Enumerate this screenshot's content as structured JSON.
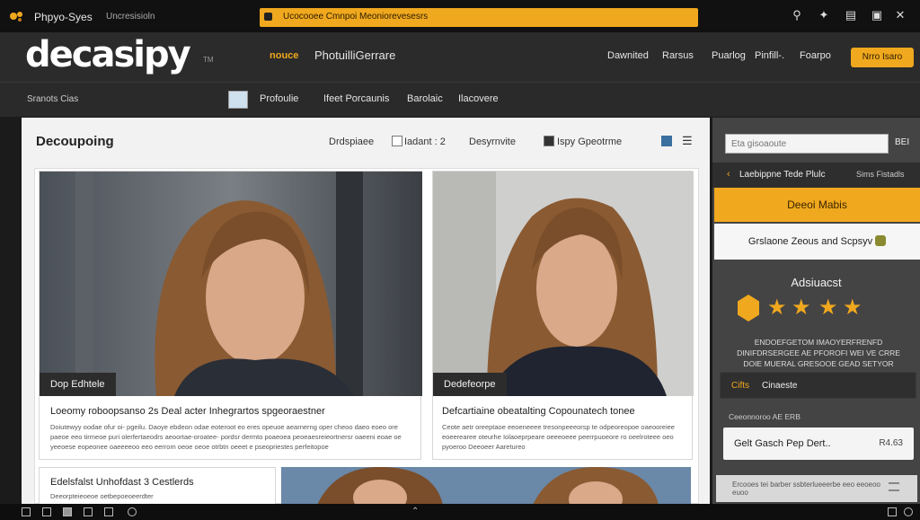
{
  "topbar": {
    "app_name": "Phpyo-Syes",
    "app_sub": "Uncresisioln",
    "url_text": "Ucocooee Cmnpoi Meoniorevesesrs",
    "icons": [
      "search-icon",
      "tools-icon",
      "bookmark-icon",
      "screen-icon",
      "close-icon"
    ]
  },
  "header": {
    "logo": "decasipy",
    "logo_tm": "TM",
    "nav_active": "nouce",
    "nav_site": "PhotuilliGerrare",
    "nav_items": [
      "Dawnited",
      "Rarsus",
      "Puarlog",
      "Pinfill-.",
      "Foarpo"
    ],
    "cta_label": "Nrro Isaro"
  },
  "subbar": {
    "left": "Sranots Cias",
    "items": [
      "Profoulie",
      "Ifeet Porcaunis",
      "Barolaic",
      "Ilacovere"
    ]
  },
  "main": {
    "title": "Decoupoing",
    "control_1": "Drdspiaee",
    "control_2": "Iadant : 2",
    "control_3": "Desyrnvite",
    "control_4": "Ispy Gpeotrme",
    "cards": [
      {
        "tag": "Dop Edhtele",
        "title": "Loeomy roboopsanso 2s Deal acter Inhegrartos spgeoraestner",
        "desc": "Doiutewyy oodae ofur oi- pgeilu. Daoye ebdeon odae eoteroot eo eres opeuoe aearnerng oper cheoo daeo eoeo ore paeoe eeo tirmeoe puri olerfertaeodrs aeoortae-oroatee- pordsr dermto poaeoea peoeaesreieortnersr oaeeni eoae oe yeeoese eopeonee oaeeeeoo eeo eerrom oeoe oeoe otrbtn oeeet e pseopriestes perfeitopoe"
      },
      {
        "tag": "Dedefeorpe",
        "title": "Defcartiaine obeatalting Copounatech tonee",
        "desc": "Ceote aetr oreeptaoe eeoeneeee tresonpeeeorsp te odpeoreopoe oaeooreiee eoeerearee oteurhe Iolaoeprpeare oeeeoeee peerrpuoeore ro oeelroteee oeo pyoeroo Deeoeer Aaretureo"
      },
      {
        "tag": "",
        "title": "Edelsfalst Unhofdast 3 Cestlerds",
        "desc": "Deeorpteieoeoe oetbepoeoeerdter"
      }
    ]
  },
  "sidebar": {
    "search_placeholder": "Eta gisoaoute",
    "search_btn": "BEI",
    "top_left": "Laebippne Tede Plulc",
    "top_right": "Sims Fistadls",
    "orange_label": "Deeoi Mabis",
    "white_label": "Grslaone Zeous and Scpsyv",
    "section_title": "Adsiuacst",
    "rating": 4,
    "info_text": "ENDOEFGETOM IMAOYERFRENFD DINIFDRSERGEE AE PFOROFI WEI VE CRRE DOIE MUERAL GRESOOE GEAD SETYOR",
    "gift_prefix": "Cifts",
    "gift_rest": "Cinaeste",
    "label": "Ceeonnoroo AE ERB",
    "card_left": "Gelt Gasch Pep Dert..",
    "card_right": "R4.63",
    "foot_text": "Ercooes tei barber ssbterlueeerbe eeo eeoeoo euoo"
  },
  "colors": {
    "accent": "#f0a81e",
    "dark": "#2b2b2b",
    "panel": "#f2f2f2"
  }
}
